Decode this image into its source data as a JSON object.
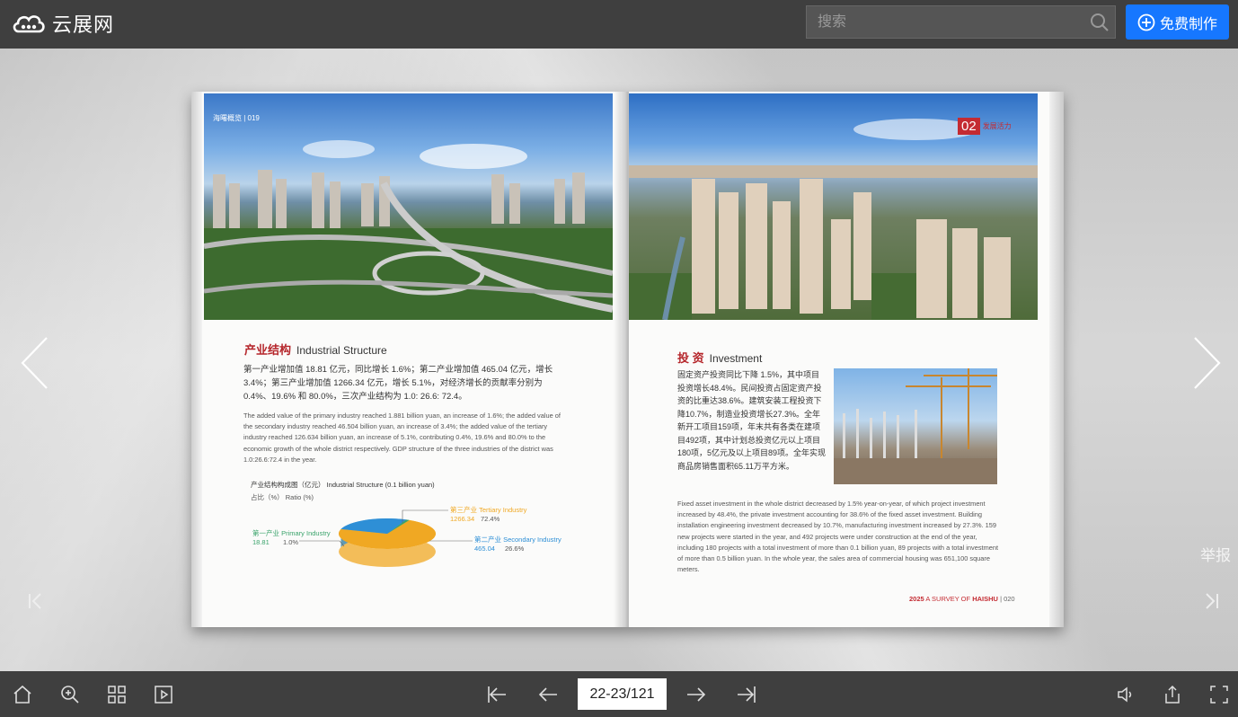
{
  "header": {
    "logo_text": "云展网",
    "search_placeholder": "搜索",
    "create_label": "免费制作"
  },
  "side": {
    "report_label": "举报"
  },
  "book": {
    "left": {
      "runhead": "海曙概览 | 019",
      "section_cn": "产业结构",
      "section_en": "Industrial Structure",
      "body_cn": "第一产业增加值 18.81 亿元，同比增长 1.6%；第二产业增加值 465.04 亿元，增长 3.4%；第三产业增加值 1266.34 亿元，增长 5.1%，对经济增长的贡献率分别为 0.4%、19.6% 和 80.0%，三次产业结构为 1.0: 26.6: 72.4。",
      "body_en": "The added value of the primary industry reached 1.881 billion yuan, an increase of 1.6%; the added value of the secondary industry reached 46.504 billion yuan, an increase of 3.4%; the added value of the tertiary industry reached 126.634 billion yuan, an increase of 5.1%, contributing 0.4%, 19.6% and 80.0% to the economic growth of the whole district respectively. GDP structure of the three industries of the district was 1.0:26.6:72.4 in the year.",
      "chart_title_cn": "产业结构构成图（亿元）",
      "chart_title_en": "Industrial Structure (0.1 billion yuan)",
      "chart_ratio_cn": "占比（%）",
      "chart_ratio_en": "Ratio (%)"
    },
    "right": {
      "badge_num": "02",
      "badge_cn": "发展活力",
      "section_cn": "投 资",
      "section_en": "Investment",
      "body_cn": "固定资产投资同比下降 1.5%，其中项目投资增长48.4%。民间投资占固定资产投资的比重达38.6%。建筑安装工程投资下降10.7%，制造业投资增长27.3%。全年新开工项目159项，年末共有各类在建项目492项，其中计划总投资亿元以上项目180项，5亿元及以上项目89项。全年实现商品房销售面积65.11万平方米。",
      "body_en": "Fixed asset investment in the whole district decreased by 1.5% year-on-year, of which project investment increased by 48.4%, the private investment accounting for 38.6% of the fixed asset investment. Building installation engineering investment decreased by 10.7%, manufacturing investment increased by 27.3%. 159 new projects were started in the year, and 492 projects were under construction at the end of the year, including 180 projects with a total investment of more than 0.1 billion yuan, 89 projects with a total investment of more than 0.5 billion yuan. In the whole year, the sales area of commercial housing was 651,100 square meters.",
      "footer_year": "2025",
      "footer_text": "A SURVEY OF",
      "footer_brand": "HAISHU",
      "footer_page": "| 020"
    }
  },
  "chart_data": {
    "type": "pie",
    "title": "产业结构构成图（亿元） Industrial Structure (0.1 billion yuan)",
    "subtitle": "占比（%） Ratio (%)",
    "slices": [
      {
        "label_cn": "第三产业",
        "label_en": "Tertiary Industry",
        "value": 1266.34,
        "ratio": "72.4%",
        "color": "#f0a823"
      },
      {
        "label_cn": "第二产业",
        "label_en": "Secondary Industry",
        "value": 465.04,
        "ratio": "26.6%",
        "color": "#2e8fd6"
      },
      {
        "label_cn": "第一产业",
        "label_en": "Primary Industry",
        "value": 18.81,
        "ratio": "1.0%",
        "color": "#3aa36b"
      }
    ]
  },
  "toolbar": {
    "page_indicator": "22-23/121"
  }
}
